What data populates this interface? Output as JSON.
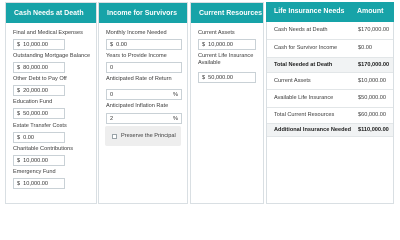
{
  "cash_needs": {
    "title": "Cash Needs at Death",
    "fields": [
      {
        "label": "Final and Medical Expenses",
        "currency": "$",
        "value": "10,000.00"
      },
      {
        "label": "Outstanding Mortgage Balance",
        "currency": "$",
        "value": "80,000.00"
      },
      {
        "label": "Other Debt to Pay Off",
        "currency": "$",
        "value": "20,000.00"
      },
      {
        "label": "Education Fund",
        "currency": "$",
        "value": "50,000.00"
      },
      {
        "label": "Estate Transfer Costs",
        "currency": "$",
        "value": "0.00"
      },
      {
        "label": "Charitable Contributions",
        "currency": "$",
        "value": "10,000.00"
      },
      {
        "label": "Emergency Fund",
        "currency": "$",
        "value": "10,000.00"
      }
    ]
  },
  "income_for_survivors": {
    "title": "Income for Survivors",
    "monthly_income_label": "Monthly Income Needed",
    "monthly_income_currency": "$",
    "monthly_income_value": "0.00",
    "years_label": "Years to Provide Income",
    "years_value": "0",
    "rate_of_return_label": "Anticipated Rate of Return",
    "rate_of_return_value": "0",
    "rate_of_return_suffix": "%",
    "inflation_label": "Anticipated Inflation Rate",
    "inflation_value": "2",
    "inflation_suffix": "%",
    "preserve_principal_label": "Preserve the Principal",
    "preserve_principal_checked": false
  },
  "current_resources": {
    "title": "Current Resources",
    "assets_label": "Current Assets",
    "assets_currency": "$",
    "assets_value": "10,000.00",
    "insurance_label_line1": "Current Life Insurance",
    "insurance_label_line2": "Available",
    "insurance_currency": "$",
    "insurance_value": "50,000.00"
  },
  "summary": {
    "col_needs": "Life Insurance Needs",
    "col_amount": "Amount",
    "rows": [
      {
        "label": "Cash Needs at Death",
        "amount": "$170,000.00",
        "total": false
      },
      {
        "label": "Cash for Survivor Income",
        "amount": "$0.00",
        "total": false
      },
      {
        "label": "Total Needed at Death",
        "amount": "$170,000.00",
        "total": true
      },
      {
        "label": "Current Assets",
        "amount": "$10,000.00",
        "total": false
      },
      {
        "label": "Available Life Insurance",
        "amount": "$50,000.00",
        "total": false
      },
      {
        "label": "Total Current Resources",
        "amount": "$60,000.00",
        "total": false
      },
      {
        "label": "Additional Insurance Needed",
        "amount": "$110,000.00",
        "total": true
      }
    ]
  },
  "colors": {
    "accent": "#17a3a8",
    "panel_border": "#d9dfe3",
    "total_row_bg": "#f1f3f4"
  }
}
